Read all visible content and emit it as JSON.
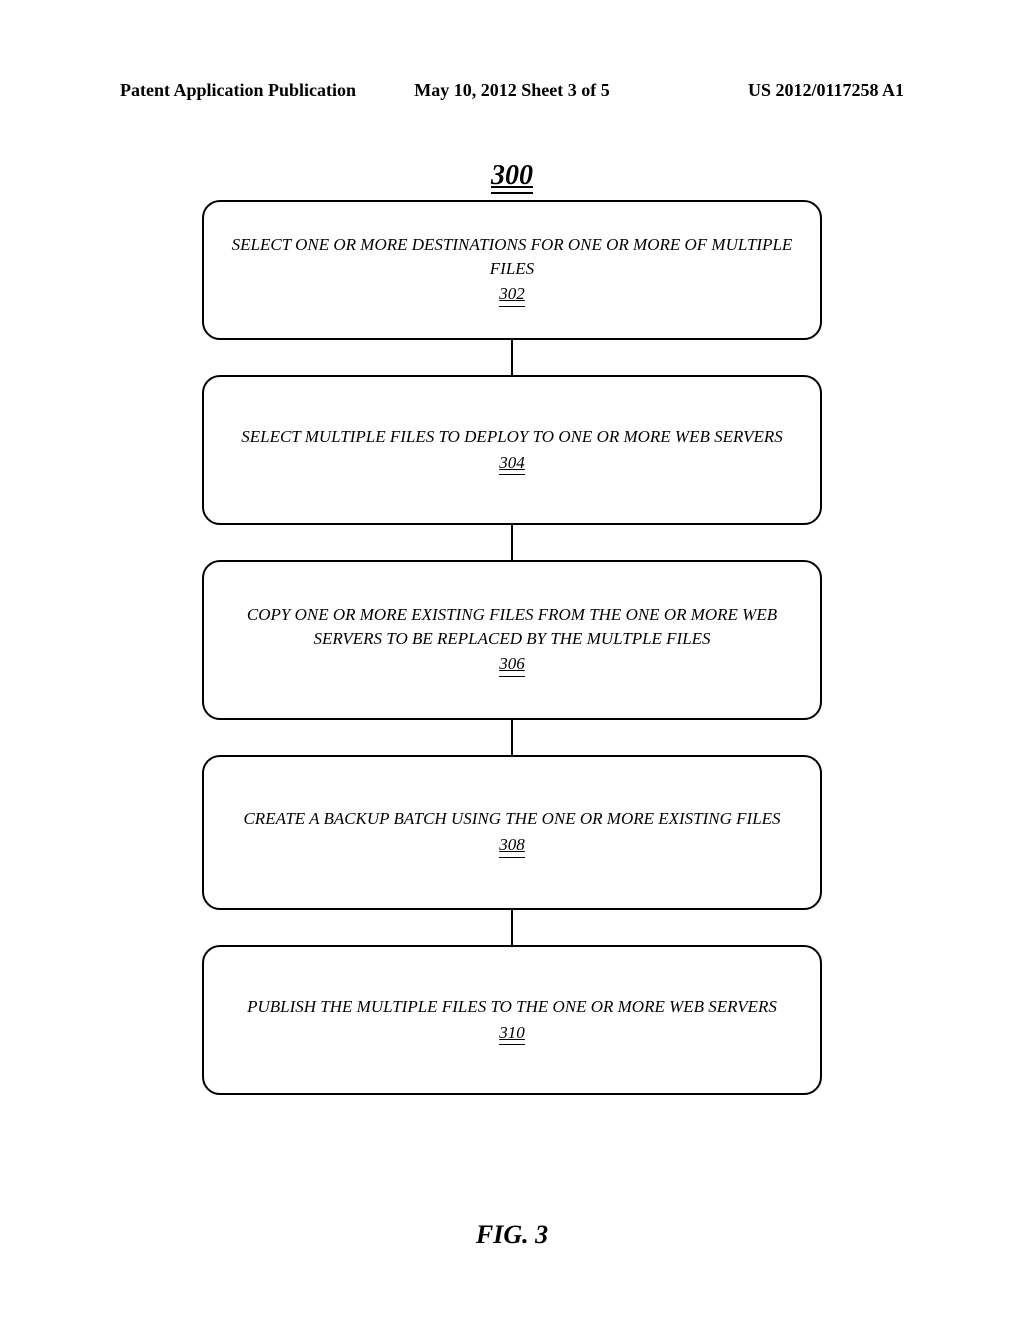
{
  "header": {
    "left": "Patent Application Publication",
    "center": "May 10, 2012  Sheet 3 of 5",
    "right": "US 2012/0117258 A1"
  },
  "figure_number": "300",
  "chart_data": {
    "type": "flowchart",
    "title": "300",
    "caption": "FIG. 3",
    "steps": [
      {
        "ref": "302",
        "text": "SELECT ONE OR MORE DESTINATIONS FOR ONE OR MORE OF MULTIPLE FILES"
      },
      {
        "ref": "304",
        "text": "SELECT MULTIPLE FILES TO DEPLOY TO ONE OR MORE WEB SERVERS"
      },
      {
        "ref": "306",
        "text": "COPY ONE OR MORE EXISTING FILES FROM THE ONE OR MORE WEB SERVERS TO BE REPLACED BY THE MULTPLE FILES"
      },
      {
        "ref": "308",
        "text": "CREATE A BACKUP BATCH USING THE ONE OR MORE EXISTING FILES"
      },
      {
        "ref": "310",
        "text": "PUBLISH THE MULTIPLE FILES TO THE ONE OR MORE WEB SERVERS"
      }
    ]
  },
  "figure_label": "FIG. 3"
}
